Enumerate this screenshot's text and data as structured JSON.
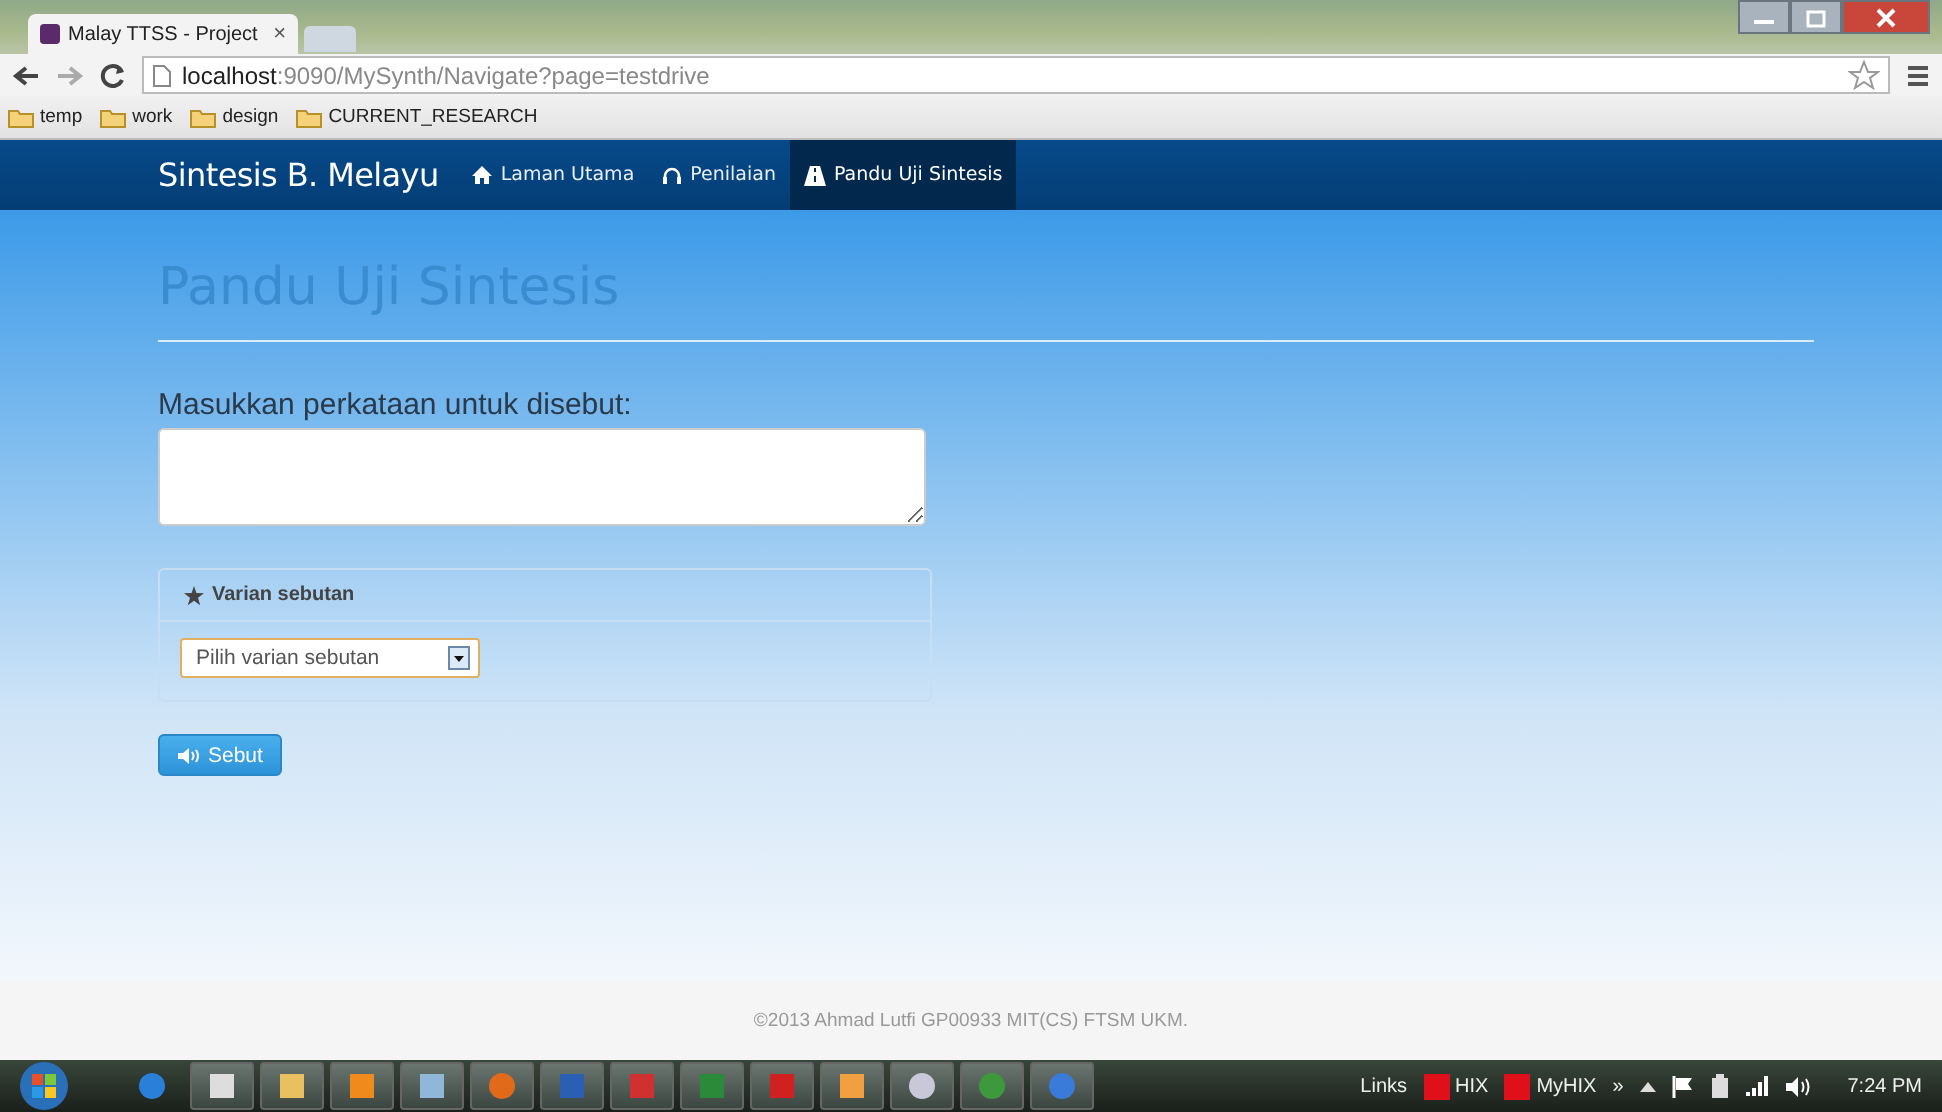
{
  "browser": {
    "tab_title": "Malay TTSS - Project",
    "tab_close": "×",
    "url_host": "localhost",
    "url_rest": ":9090/MySynth/Navigate?page=testdrive",
    "bookmarks": [
      "temp",
      "work",
      "design",
      "CURRENT_RESEARCH"
    ]
  },
  "navbar": {
    "brand": "Sintesis B. Melayu",
    "items": [
      {
        "label": "Laman Utama",
        "selected": false
      },
      {
        "label": "Penilaian",
        "selected": false
      },
      {
        "label": "Pandu Uji Sintesis",
        "selected": true
      }
    ]
  },
  "page": {
    "heading": "Pandu Uji Sintesis",
    "prompt": "Masukkan perkataan untuk disebut:",
    "panel_title": "Varian sebutan",
    "select_placeholder": "Pilih varian sebutan",
    "button": "Sebut"
  },
  "footer": "©2013 Ahmad Lutfi GP00933 MIT(CS) FTSM UKM.",
  "taskbar": {
    "apps": [
      {
        "kind": "ie",
        "pinned_only": true
      },
      {
        "kind": "skull",
        "pinned_only": false
      },
      {
        "kind": "explorer",
        "pinned_only": false
      },
      {
        "kind": "media",
        "pinned_only": false
      },
      {
        "kind": "notes",
        "pinned_only": false
      },
      {
        "kind": "firefox",
        "pinned_only": false
      },
      {
        "kind": "word",
        "pinned_only": false
      },
      {
        "kind": "pdf",
        "pinned_only": false
      },
      {
        "kind": "excel",
        "pinned_only": false
      },
      {
        "kind": "blocks",
        "pinned_only": false
      },
      {
        "kind": "shapes",
        "pinned_only": false
      },
      {
        "kind": "gear",
        "pinned_only": false
      },
      {
        "kind": "chrome",
        "pinned_only": false
      },
      {
        "kind": "itunes",
        "pinned_only": false
      }
    ],
    "links_label": "Links",
    "toolbar_links": [
      "HIX",
      "MyHIX"
    ],
    "more": "»",
    "time": "7:24 PM"
  }
}
